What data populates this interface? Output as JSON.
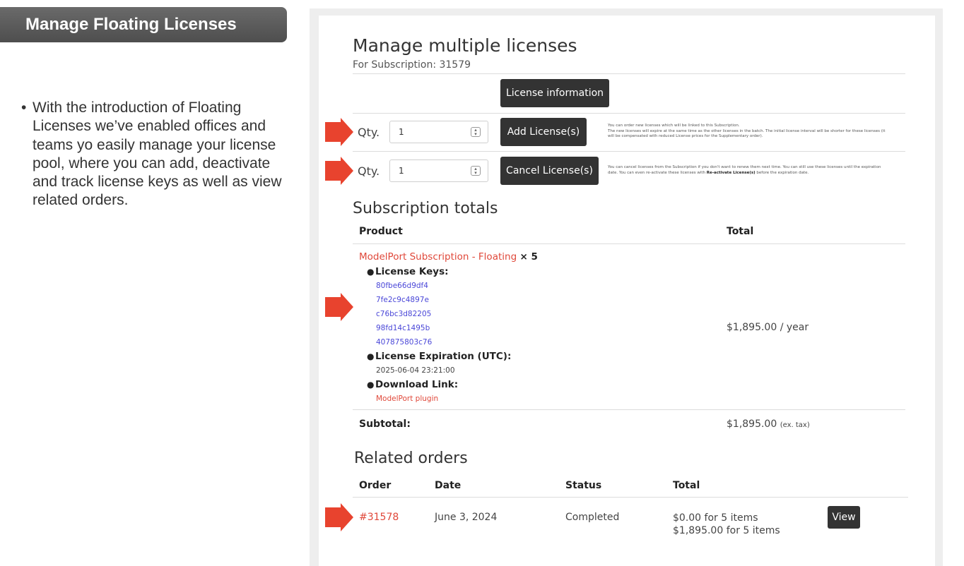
{
  "slide": {
    "title": "Manage Floating Licenses",
    "bullet": "With the introduction of Floating Licenses we’ve enabled offices and teams yo easily manage your license pool, where you can add, deactivate and track license keys as well as view related orders."
  },
  "manage": {
    "heading": "Manage multiple licenses",
    "subscription_line": "For Subscription: 31579",
    "license_info_button": "License information",
    "add_row": {
      "qty_label": "Qty.",
      "qty_value": "1",
      "button": "Add License(s)",
      "note_line1": "You can order new licenses which will be linked to this Subscription.",
      "note_line2": "The new licenses will expire at the same time as the other licenses in the batch. The initial license interval will be shorter for these licenses (it",
      "note_line3": "will be compensated with reduced License prices for the Supplementary order)."
    },
    "cancel_row": {
      "qty_label": "Qty.",
      "qty_value": "1",
      "button": "Cancel License(s)",
      "note_line1": "You can cancel licenses from the Subscription if you don't want to renew them next time. You can still use these licenses until the expiration",
      "note_line2_pre": "date. You can even re-activate these licenses with ",
      "note_line2_bold": "Re-activate License(s)",
      "note_line2_post": " before the expiration date."
    }
  },
  "totals": {
    "heading": "Subscription totals",
    "col_product": "Product",
    "col_total": "Total",
    "product_name": "ModelPort Subscription - Floating",
    "product_qty": "× 5",
    "keys_label": "License Keys:",
    "keys": [
      "80fbe66d9df4",
      "7fe2c9c4897e",
      "c76bc3d82205",
      "98fd14c1495b",
      "407875803c76"
    ],
    "expiration_label": "License Expiration (UTC):",
    "expiration_value": "2025-06-04 23:21:00",
    "download_label": "Download Link:",
    "download_link": "ModelPort plugin",
    "line_total": "$1,895.00 / year",
    "subtotal_label": "Subtotal:",
    "subtotal_value": "$1,895.00",
    "subtotal_suffix": "(ex. tax)"
  },
  "related": {
    "heading": "Related orders",
    "columns": [
      "Order",
      "Date",
      "Status",
      "Total"
    ],
    "rows": [
      {
        "order": "#31578",
        "date": "June 3, 2024",
        "status": "Completed",
        "total_line1": "$0.00 for 5 items",
        "total_line2": "$1,895.00 for 5 items",
        "action": "View"
      }
    ]
  },
  "colors": {
    "accent_red": "#e0483a",
    "link_blue": "#4a47d8",
    "button_dark": "#333333",
    "arrow": "#e8432e"
  },
  "icons": [
    "arrow-right-icon",
    "stepper-icon"
  ]
}
